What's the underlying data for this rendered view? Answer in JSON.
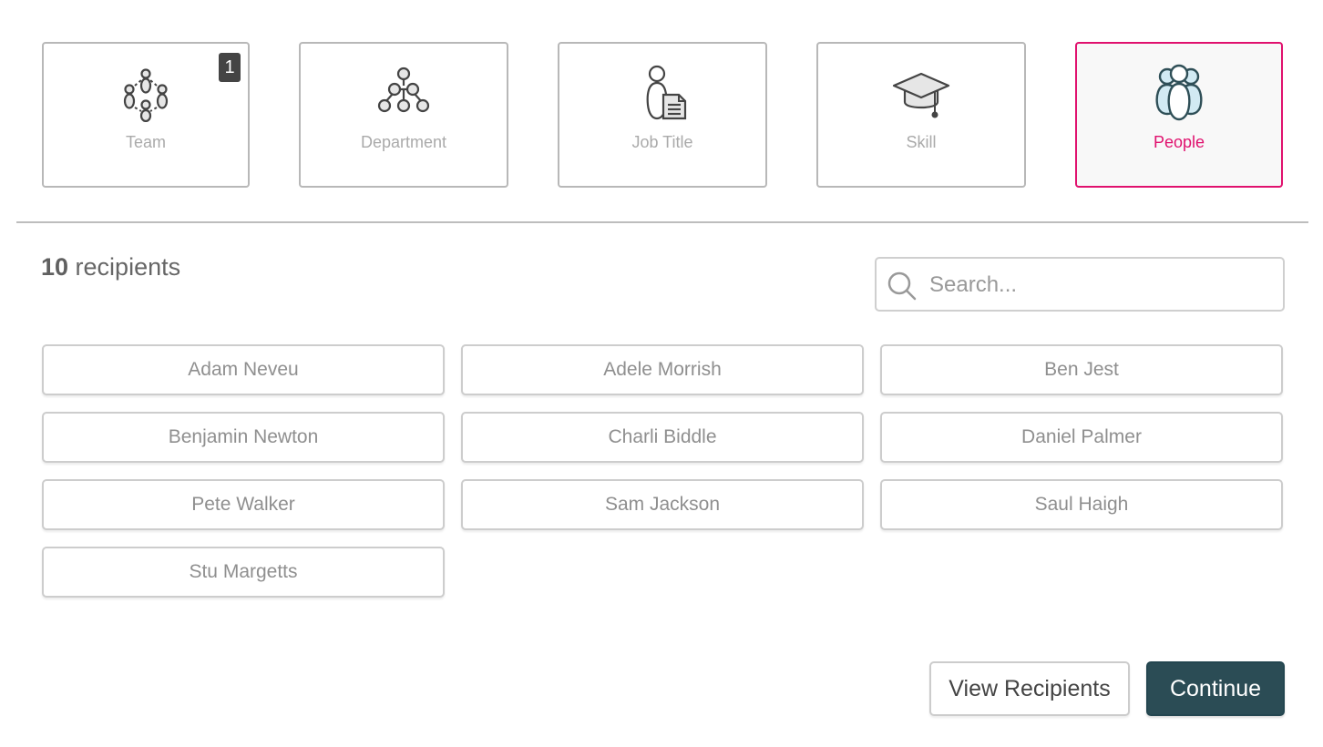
{
  "categories": [
    {
      "label": "Team",
      "icon": "team-icon",
      "badge": "1",
      "active": false
    },
    {
      "label": "Department",
      "icon": "department-icon",
      "badge": null,
      "active": false
    },
    {
      "label": "Job Title",
      "icon": "job-title-icon",
      "badge": null,
      "active": false
    },
    {
      "label": "Skill",
      "icon": "graduation-cap-icon",
      "badge": null,
      "active": false
    },
    {
      "label": "People",
      "icon": "people-icon",
      "badge": null,
      "active": true
    }
  ],
  "recipients": {
    "count": "10",
    "count_suffix": " recipients"
  },
  "search": {
    "placeholder": "Search...",
    "value": ""
  },
  "people": [
    "Adam Neveu",
    "Adele Morrish",
    "Ben Jest",
    "Benjamin Newton",
    "Charli Biddle",
    "Daniel Palmer",
    "Pete Walker",
    "Sam Jackson",
    "Saul Haigh",
    "Stu Margetts"
  ],
  "actions": {
    "view_recipients": "View Recipients",
    "continue": "Continue"
  },
  "colors": {
    "accent": "#e0116e",
    "primary_button": "#2b4c55",
    "badge": "#444444"
  }
}
